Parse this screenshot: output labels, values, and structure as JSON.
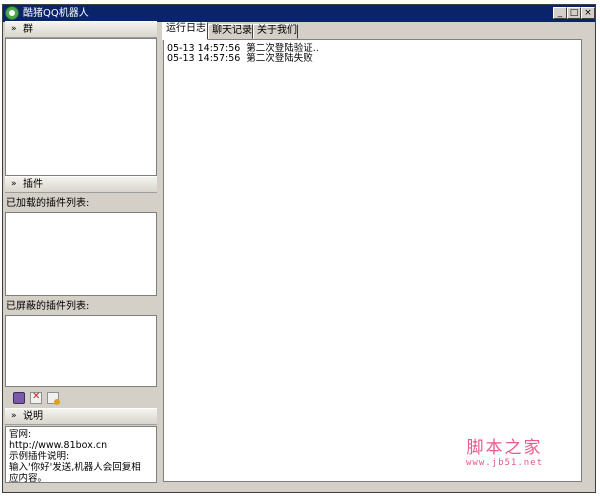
{
  "window": {
    "title": "酷猪QQ机器人",
    "icon": "app-icon",
    "controls": {
      "minimize": "_",
      "maximize": "□",
      "close": "×"
    }
  },
  "left_panel": {
    "group": {
      "chevron": "»",
      "header": "群"
    },
    "plugins": {
      "chevron": "»",
      "header": "插件",
      "loaded_label": "已加载的插件列表:",
      "blocked_label": "已屏蔽的插件列表:",
      "toolbar_icons": [
        "plugin-icon",
        "delete-icon",
        "add-icon"
      ]
    },
    "description": {
      "chevron": "»",
      "header": "说明",
      "lines": [
        "官网:",
        "http://www.81box.cn",
        "示例插件说明:",
        "输入'你好'发送,机器人会回复相",
        "应内容。"
      ]
    }
  },
  "tabs": [
    {
      "label": "运行日志",
      "active": true
    },
    {
      "label": "聊天记录",
      "active": false
    },
    {
      "label": "关于我们",
      "active": false
    }
  ],
  "log": [
    {
      "time": "05-13 14:57:56",
      "message": "第二次登陆验证.."
    },
    {
      "time": "05-13 14:57:56",
      "message": "第二次登陆失败"
    }
  ],
  "watermark": {
    "main": "脚本之家",
    "sub": "www.jb51.net"
  }
}
